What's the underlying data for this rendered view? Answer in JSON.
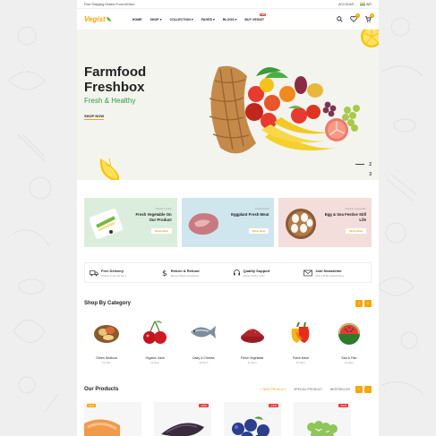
{
  "topbar": {
    "promo": "Free Shipping Orders From All Item",
    "account": "ACCOUNT",
    "currency": "INR"
  },
  "header": {
    "logo": "Vegist",
    "nav": [
      "HOME",
      "SHOP",
      "COLLECTION",
      "PAGES",
      "BLOGS",
      "BUY VEGIST"
    ],
    "nav_badge": "new",
    "wishlist_count": "0",
    "cart_count": "0"
  },
  "hero": {
    "title": "Farmfood Freshbox",
    "subtitle": "Fresh & Healthy",
    "cta": "SHOP NOW",
    "slides": [
      "2",
      "3"
    ]
  },
  "banners": [
    {
      "small": "Organic Juice",
      "title": "Fresh Vegetable On Our Product",
      "btn": "Shop Now"
    },
    {
      "small": "Fresh Food",
      "title": "Eggplant Fresh Meat",
      "btn": "Shop Now"
    },
    {
      "small": "Organic egg plant",
      "title": "Egg & Sea Festive Still Life",
      "btn": "Shop Now"
    }
  ],
  "features": [
    {
      "title": "Free Delivery",
      "sub": "Orders From All Item",
      "icon": "truck-icon"
    },
    {
      "title": "Return & Refund",
      "sub": "Money Back Guarantee",
      "icon": "dollar-icon"
    },
    {
      "title": "Quality Support",
      "sub": "Alway Online 24/7",
      "icon": "headset-icon"
    },
    {
      "title": "Join Newsletter",
      "sub": "20% Off By Subscribing",
      "icon": "mail-icon"
    }
  ],
  "categories": {
    "title": "Shop By Category",
    "items": [
      {
        "name": "Green Seafood",
        "count": "12 Item"
      },
      {
        "name": "Organic Juice",
        "count": "12 Item"
      },
      {
        "name": "Dairy & Cheese",
        "count": "12 Item"
      },
      {
        "name": "Fresh Vegetable",
        "count": "12 Item"
      },
      {
        "name": "Fresh Meat",
        "count": "12 Item"
      },
      {
        "name": "Sea & Fish",
        "count": "12 Item"
      }
    ]
  },
  "products": {
    "title": "Our Products",
    "tabs": [
      "NEW PRODUCT",
      "SPECIAL PRODUCT",
      "BESTSELLER"
    ],
    "tags": [
      "New",
      "-18%",
      "-15%",
      "-12%"
    ]
  },
  "colors": {
    "accent": "#f7a600",
    "green": "#2e9a3c",
    "sale": "#e83a3a"
  }
}
